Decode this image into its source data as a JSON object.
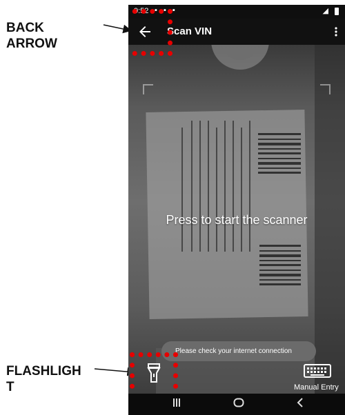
{
  "callouts": {
    "back_arrow_line1": "BACK",
    "back_arrow_line2": "ARROW",
    "flashlight_line1": "FLASHLIGH",
    "flashlight_line2": "T"
  },
  "status_bar": {
    "time": "9:52"
  },
  "app_bar": {
    "title": "Scan VIN",
    "back_icon": "arrow-left-icon",
    "menu_icon": "kebab-menu-icon"
  },
  "camera": {
    "prompt": "Press to start the scanner"
  },
  "toast": {
    "message": "Please check your internet connection"
  },
  "bottom_actions": {
    "flashlight_icon": "flashlight-icon",
    "manual_entry_icon": "keyboard-icon",
    "manual_entry_label": "Manual Entry"
  },
  "nav_bar": {
    "recents_icon": "recents-icon",
    "home_icon": "home-icon",
    "back_icon": "back-chevron-icon"
  },
  "colors": {
    "highlight": "#e60000",
    "app_bar": "#111111",
    "toast": "#6b6b6b"
  }
}
